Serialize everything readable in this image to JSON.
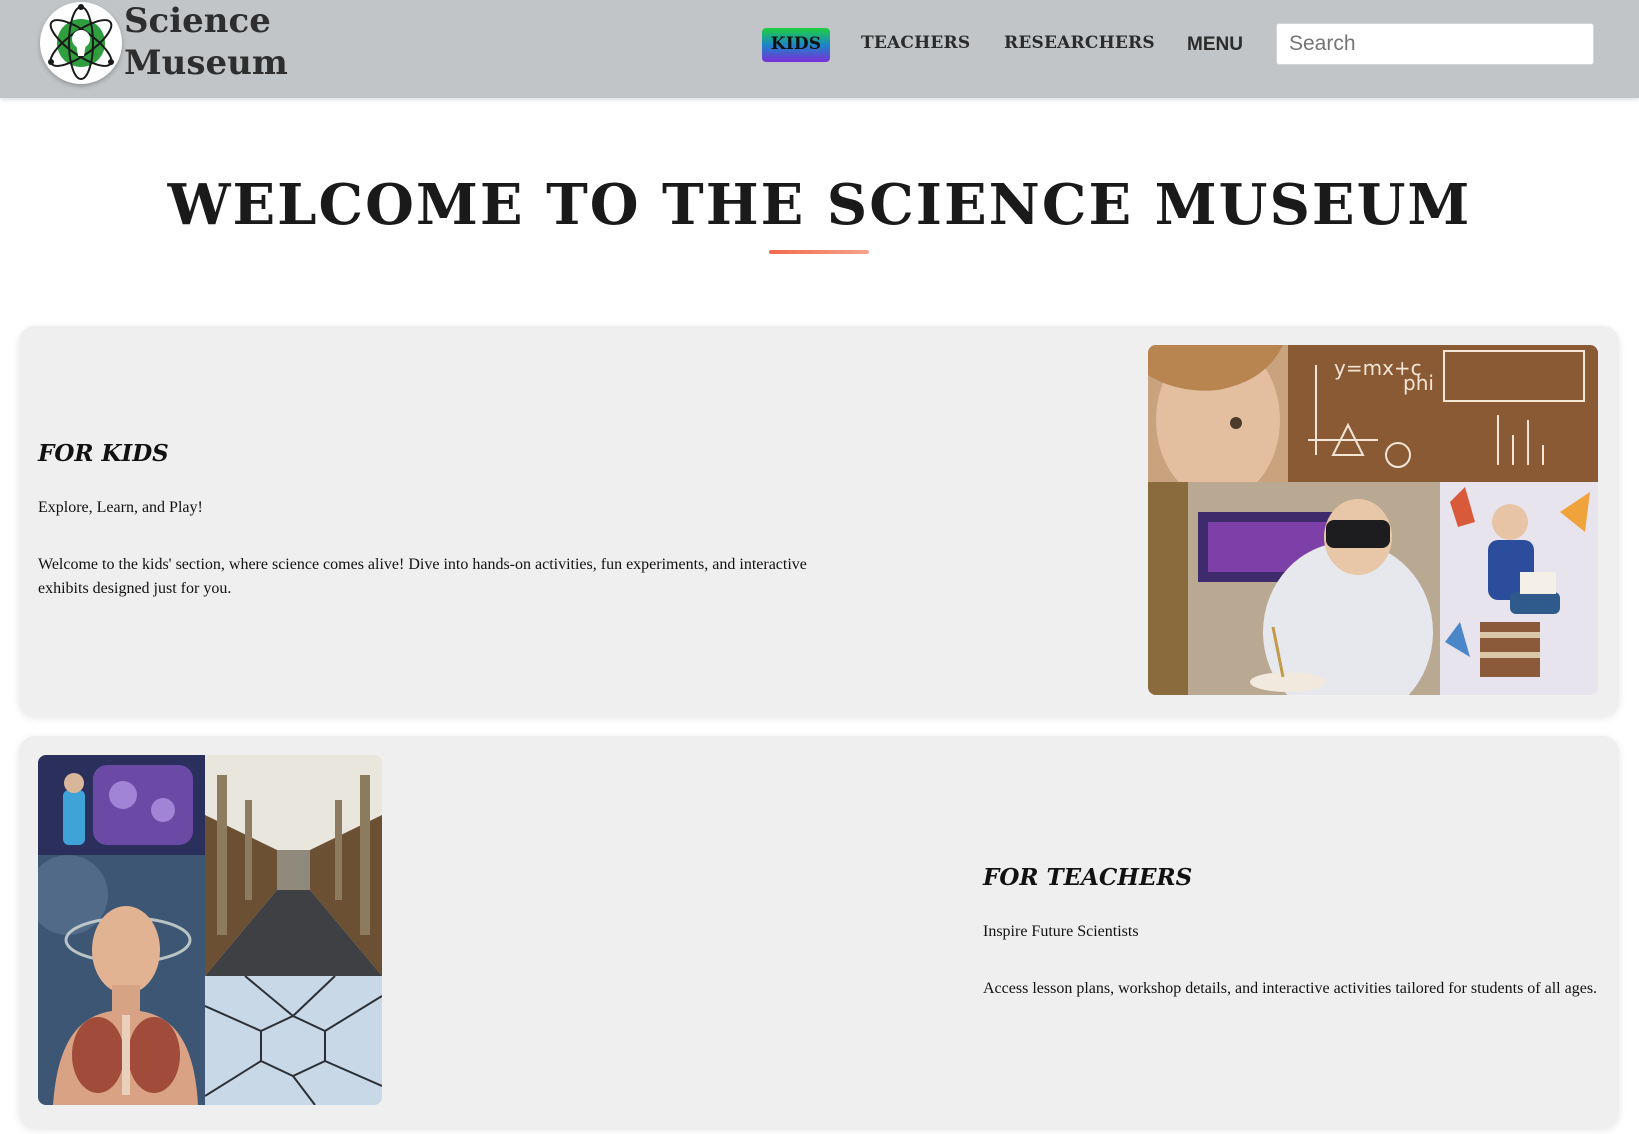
{
  "brand": {
    "name_line1": "Science",
    "name_line2": "Museum",
    "logo_icon": "atom-keyhole-logo",
    "logo_color": "#2e9e3e"
  },
  "nav": {
    "kids": "KIDS",
    "teachers": "TEACHERS",
    "researchers": "RESEARCHERS",
    "menu": "MENU"
  },
  "search": {
    "placeholder": "Search"
  },
  "hero": {
    "title": "WELCOME TO THE SCIENCE MUSEUM",
    "underline_color": "#f06a4d"
  },
  "kids_card": {
    "heading": "FOR KIDS",
    "tagline": "Explore, Learn, and Play!",
    "body": "Welcome to the kids' section, where science comes alive! Dive into hands-on activities, fun experiments, and interactive exhibits designed just for you."
  },
  "teachers_card": {
    "heading": "FOR TEACHERS",
    "tagline": "Inspire Future Scientists",
    "body": "Access lesson plans, workshop details, and interactive activities tailored for students of all ages."
  },
  "colors": {
    "header_bg": "#c2c5c8",
    "card_bg": "#efefef",
    "kids_gradient": [
      "#1fcf3e",
      "#1b86c9",
      "#7a2fd6"
    ]
  }
}
